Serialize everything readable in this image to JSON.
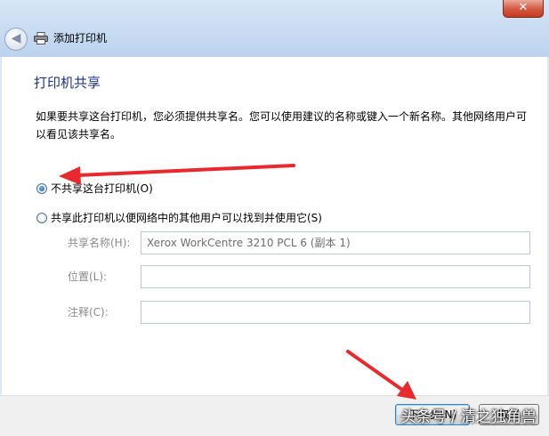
{
  "window": {
    "title": "添加打印机",
    "close_label": "✕"
  },
  "heading": "打印机共享",
  "description": "如果要共享这台打印机，您必须提供共享名。您可以使用建议的名称或键入一个新名称。其他网络用户可以看见该共享名。",
  "options": {
    "no_share": {
      "label": "不共享这台打印机(O)",
      "selected": true
    },
    "share": {
      "label": "共享此打印机以便网络中的其他用户可以找到并使用它(S)",
      "selected": false
    }
  },
  "fields": {
    "share_name": {
      "label": "共享名称(H):",
      "value": "Xerox WorkCentre 3210 PCL 6 (副本 1)"
    },
    "location": {
      "label": "位置(L):",
      "value": ""
    },
    "comment": {
      "label": "注释(C):",
      "value": ""
    }
  },
  "buttons": {
    "next": "下一步(N)",
    "cancel": "取消"
  },
  "watermark": "头条号 / 清之独角兽",
  "colors": {
    "heading": "#1e3287",
    "annotation_arrow": "#e8292e"
  }
}
